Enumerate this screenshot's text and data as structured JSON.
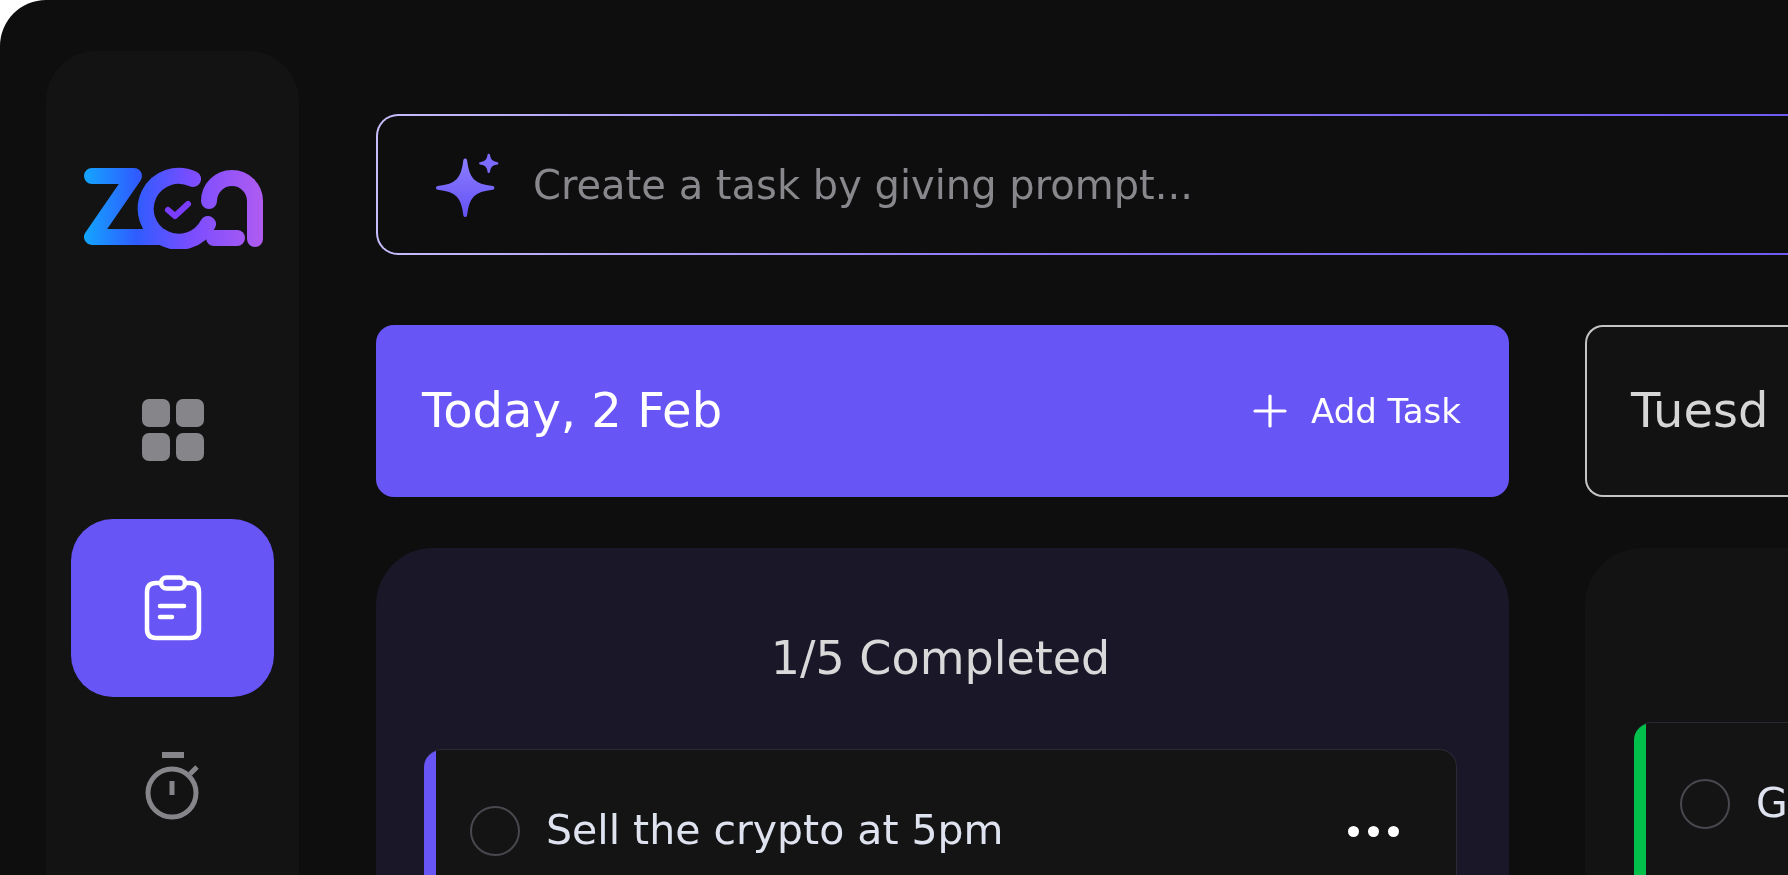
{
  "sidebar": {
    "items": [
      {
        "kind": "grid",
        "selected": false
      },
      {
        "kind": "clipboard",
        "selected": true
      },
      {
        "kind": "stopwatch",
        "selected": false
      }
    ]
  },
  "prompt": {
    "placeholder": "Create a task by giving prompt..."
  },
  "columns": [
    {
      "title": "Today, 2 Feb",
      "selected": true,
      "add_label": "Add Task",
      "progress": "1/5 Completed",
      "tasks": [
        {
          "title": "Sell the crypto at 5pm",
          "checked": false,
          "menu": true,
          "color": "#6855f6"
        }
      ]
    },
    {
      "title": "Tuesd",
      "selected": false,
      "tasks": [
        {
          "title": "G",
          "checked": false,
          "menu": false,
          "color": "#00c04b"
        }
      ]
    }
  ]
}
